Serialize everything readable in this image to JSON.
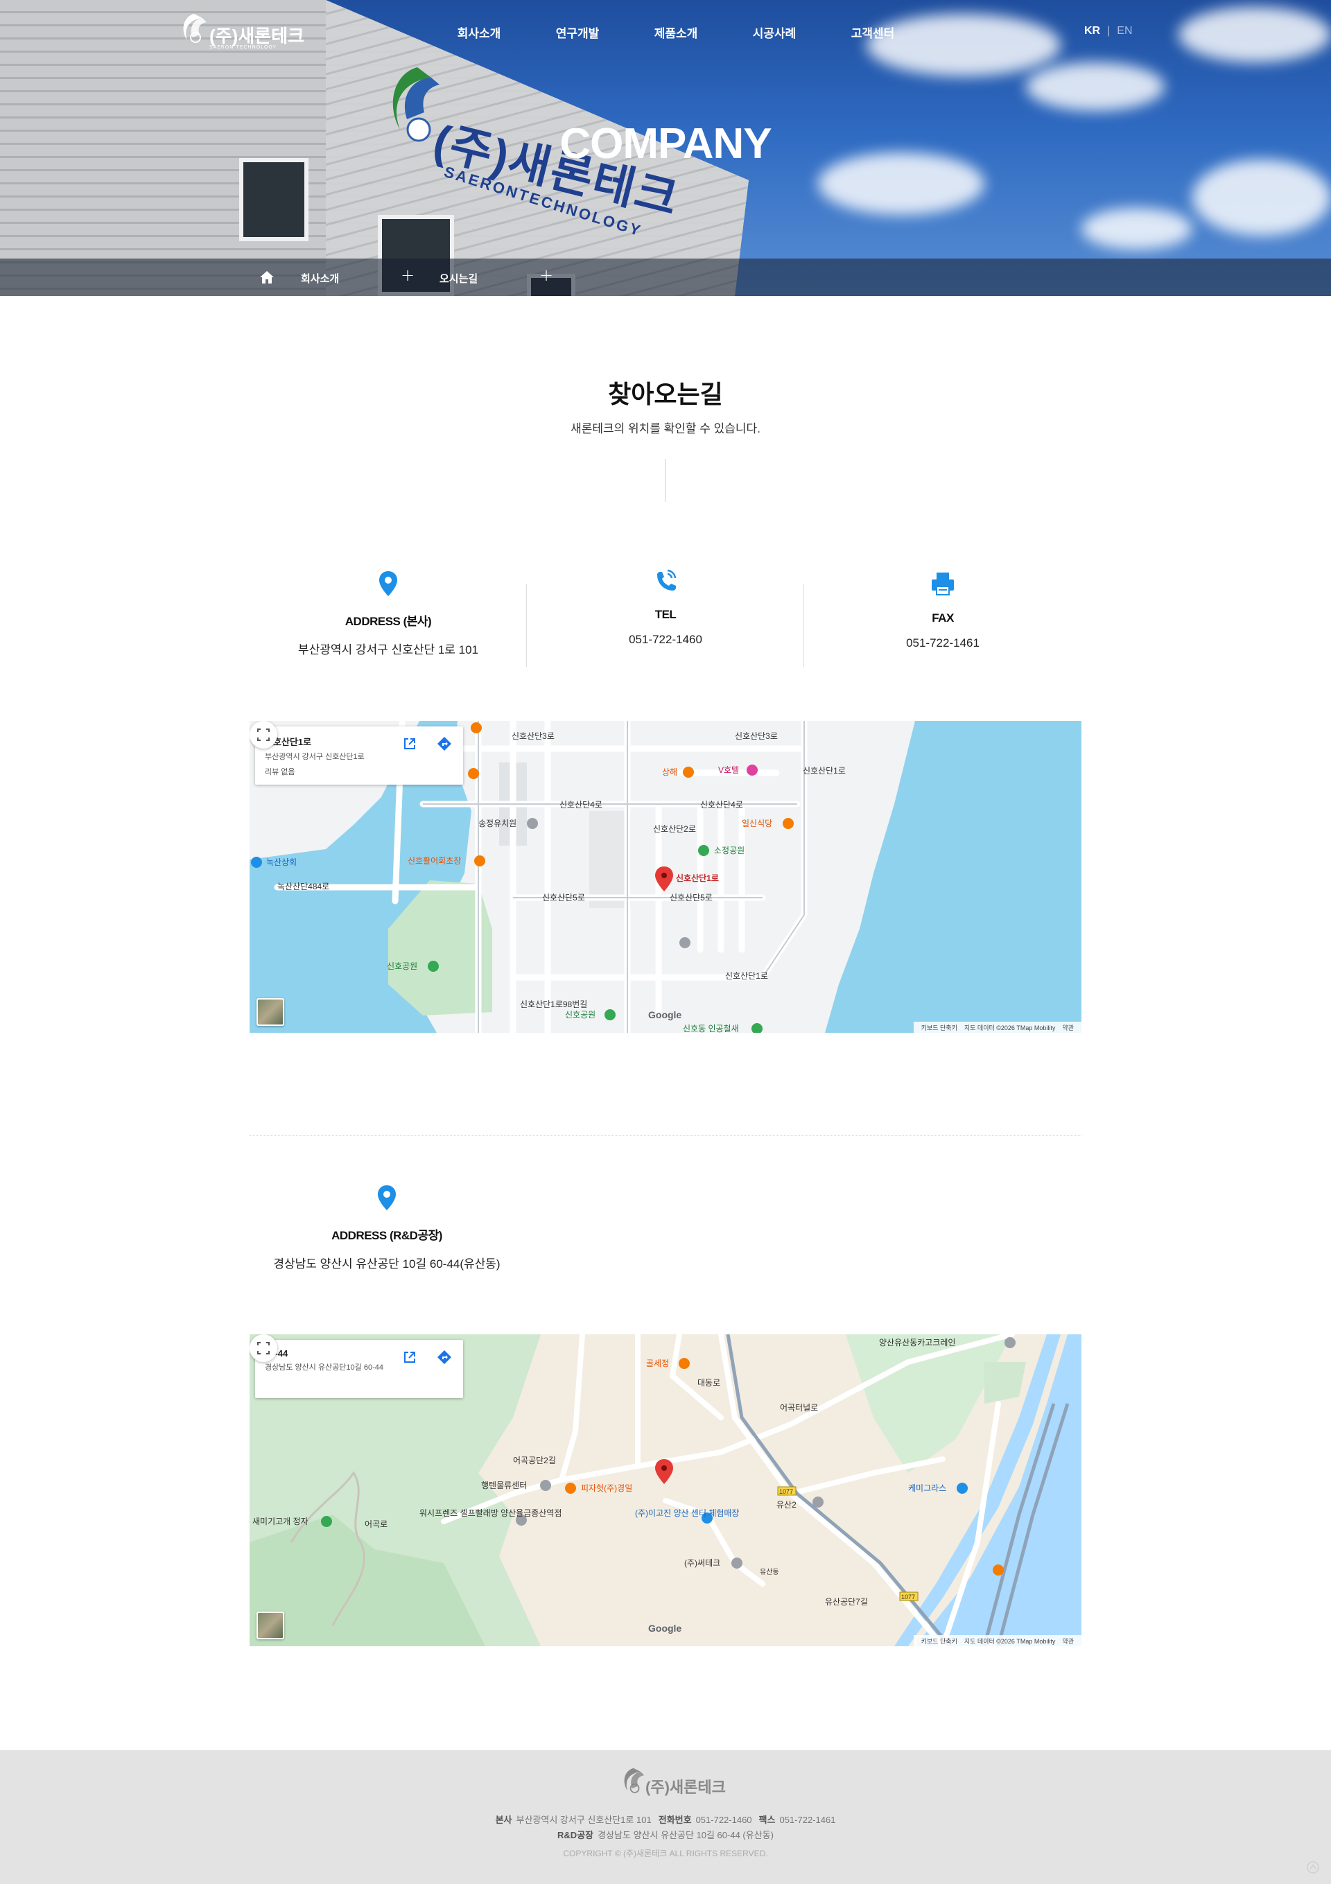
{
  "header": {
    "logo_text": "(주)새론테크",
    "logo_sub": "SAERON TECHNOLOGY",
    "sign_text": "(주)새론테크",
    "sign_sub": "SAERONTECHNOLOGY",
    "nav": [
      "회사소개",
      "연구개발",
      "제품소개",
      "시공사례",
      "고객센터"
    ],
    "lang_kr": "KR",
    "lang_en": "EN",
    "hero_title": "COMPANY"
  },
  "breadcrumb": {
    "item1": "회사소개",
    "item2": "오시는길"
  },
  "section": {
    "title": "찾아오는길",
    "subtitle": "새론테크의 위치를 확인할 수 있습니다."
  },
  "info_hq": {
    "address_label": "ADDRESS (본사)",
    "address": "부산광역시 강서구 신호산단 1로 101",
    "tel_label": "TEL",
    "tel": "051-722-1460",
    "fax_label": "FAX",
    "fax": "051-722-1461"
  },
  "map1": {
    "card_title": "신호산단1로",
    "card_address": "부산광역시 강서구 신호산단1로",
    "card_review": "리뷰 없음",
    "marker_label": "신호산단1로",
    "labels": {
      "l1": "신호산단3로",
      "l2": "신호산단3로",
      "l3": "신호산단1로",
      "l4": "신호산단4로",
      "l5": "신호산단4로",
      "l6": "송정유치원",
      "l7": "신호산단2로",
      "l8": "일신식당",
      "l9": "소정공원",
      "l10": "녹산상회",
      "l11": "녹산산단484로",
      "l12": "신호활어회초장",
      "l13": "신호산단5로",
      "l14": "신호산단5로",
      "l15": "신호공원",
      "l16": "신호산단1로98번길",
      "l17": "신호공원",
      "l18": "신호동 인공철새",
      "l19": "상해",
      "l20": "V호텔",
      "l21": "신호산단1로"
    },
    "google": "Google",
    "attr": [
      "키보드 단축키",
      "지도 데이터 ©2026 TMap Mobility",
      "약관"
    ]
  },
  "info_rd": {
    "address_label": "ADDRESS (R&D공장)",
    "address": "경상남도 양산시 유산공단 10길 60-44(유산동)"
  },
  "map2": {
    "card_title": "60-44",
    "card_address": "경상남도 양산시 유산공단10길 60-44",
    "labels": {
      "l1": "양산유산동카고크레인",
      "l2": "골세정",
      "l3": "대동로",
      "l4": "어곡터널로",
      "l5": "행텐물류센터",
      "l6": "피자헛(주)경일",
      "l7": "워시프렌즈 셀프빨래방 양산율금종산역점",
      "l8": "(주)이고진 양산 센터 체험매장",
      "l9": "(주)써테크",
      "l10": "케미그라스",
      "l11": "새미기고개 정자",
      "l12": "어곡로",
      "l13": "유산2",
      "l14": "유산공단7길",
      "l15": "1077",
      "l16": "1077",
      "l17": "어곡공단2길",
      "l18": "유산동"
    },
    "google": "Google",
    "attr": [
      "키보드 단축키",
      "지도 데이터 ©2026 TMap Mobility",
      "약관"
    ]
  },
  "footer": {
    "logo_text": "(주)새론테크",
    "hq_label": "본사",
    "hq_address": "부산광역시 강서구 신호산단1로 101",
    "tel_label": "전화번호",
    "tel": "051-722-1460",
    "fax_label": "팩스",
    "fax": "051-722-1461",
    "rd_label": "R&D공장",
    "rd_address": "경상남도 양산시 유산공단 10길 60-44 (유산동)",
    "copyright": "COPYRIGHT © (주)새론테크 ALL RIGHTS RESERVED."
  },
  "colors": {
    "accent": "#1e8fe6",
    "footer_bg": "#e3e3e3",
    "water": "#8fd2ee",
    "park": "#c8e6c9",
    "marker": "#e53935"
  }
}
